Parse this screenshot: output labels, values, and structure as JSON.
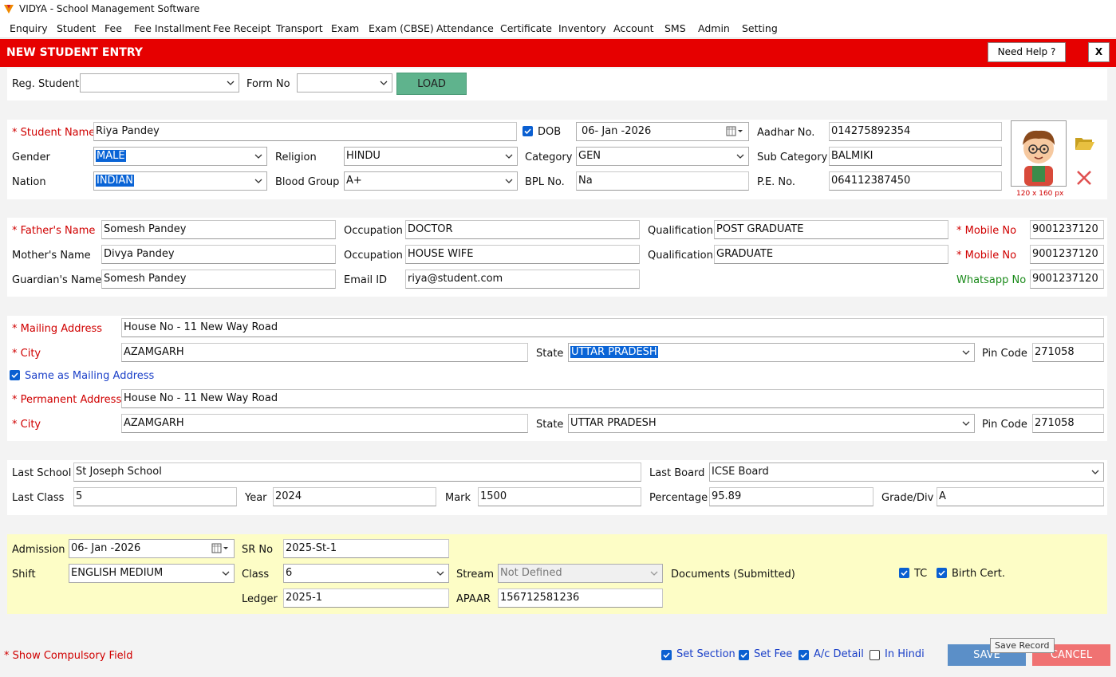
{
  "window": {
    "title": "VIDYA - School Management Software",
    "logo_icon": "vidya-logo-icon"
  },
  "menu": [
    "Enquiry",
    "Student",
    "Fee",
    "Fee Installment",
    "Fee Receipt",
    "Transport",
    "Exam",
    "Exam (CBSE)",
    "Attendance",
    "Certificate",
    "Inventory",
    "Account",
    "SMS",
    "Admin",
    "Setting"
  ],
  "header": {
    "title": "NEW STUDENT ENTRY",
    "help_label": "Need Help ?",
    "close_label": "X",
    "color": "#e60000"
  },
  "load_bar": {
    "reg_label": "Reg. Student",
    "reg_value": "",
    "form_label": "Form No",
    "form_value": "",
    "load_label": "LOAD"
  },
  "student": {
    "name_label": "* Student Name",
    "name": "Riya Pandey",
    "dob_label": "DOB",
    "dob": "06- Jan -2026",
    "dob_checked": true,
    "aadhar_label": "Aadhar No.",
    "aadhar": "014275892354",
    "gender_label": "Gender",
    "gender": "MALE",
    "religion_label": "Religion",
    "religion": "HINDU",
    "category_label": "Category",
    "category": "GEN",
    "subcat_label": "Sub Category",
    "subcat": "BALMIKI",
    "nation_label": "Nation",
    "nation": "INDIAN",
    "blood_label": "Blood Group",
    "blood": "A+",
    "bpl_label": "BPL No.",
    "bpl": "Na",
    "pe_label": "P.E. No.",
    "pe": "064112387450",
    "photo_size": "120 x 160 px"
  },
  "parents": {
    "father_label": "* Father's Name",
    "father": "Somesh Pandey",
    "occ_label": "Occupation",
    "father_occ": "DOCTOR",
    "qual_label": "Qualification",
    "father_qual": "POST GRADUATE",
    "mobile_label1": "* Mobile  No",
    "father_mobile": "9001237120",
    "mother_label": "Mother's Name",
    "mother": "Divya Pandey",
    "mother_occ": "HOUSE WIFE",
    "mother_qual": "GRADUATE",
    "mobile_label2": "* Mobile No",
    "mother_mobile": "9001237120",
    "guardian_label": "Guardian's Name",
    "guardian": "Somesh Pandey",
    "email_label": "Email ID",
    "email": "riya@student.com",
    "whatsapp_label": "Whatsapp No",
    "whatsapp": "9001237120"
  },
  "address": {
    "mailing_label": "* Mailing Address",
    "mailing": "House No - 11 New Way Road",
    "city_label": "* City",
    "mailing_city": "AZAMGARH",
    "state_label": "State",
    "mailing_state": "UTTAR PRADESH",
    "pin_label": "Pin Code",
    "mailing_pin": "271058",
    "same_label": "Same as Mailing Address",
    "same_checked": true,
    "permanent_label": "* Permanent Address",
    "permanent": "House No - 11 New Way Road",
    "permanent_city": "AZAMGARH",
    "permanent_state": "UTTAR PRADESH",
    "permanent_pin": "271058"
  },
  "previous": {
    "school_label": "Last School",
    "school": "St Joseph School",
    "board_label": "Last Board",
    "board": "ICSE Board",
    "class_label": "Last Class",
    "class": "5",
    "year_label": "Year",
    "year": "2024",
    "mark_label": "Mark",
    "mark": "1500",
    "pct_label": "Percentage",
    "pct": "95.89",
    "grade_label": "Grade/Div",
    "grade": "A"
  },
  "admission": {
    "adm_label": "Admission",
    "adm_date": "06- Jan -2026",
    "sr_label": "SR No",
    "sr": "2025-St-1",
    "shift_label": "Shift",
    "shift": "ENGLISH MEDIUM",
    "class_label": "Class",
    "class": "6",
    "stream_label": "Stream",
    "stream": "Not Defined",
    "docs_label": "Documents (Submitted)",
    "tc_label": "TC",
    "tc_checked": true,
    "birth_label": "Birth Cert.",
    "birth_checked": true,
    "ledger_label": "Ledger",
    "ledger": "2025-1",
    "apaar_label": "APAAR",
    "apaar": "156712581236",
    "bg_color": "#fdfdc6"
  },
  "footer": {
    "compulsory_label": "* Show Compulsory Field",
    "set_section_label": "Set Section",
    "set_section": true,
    "set_fee_label": "Set Fee",
    "set_fee": true,
    "ac_detail_label": "A/c Detail",
    "ac_detail": true,
    "hindi_label": "In Hindi",
    "hindi": false,
    "save_label": "SAVE",
    "cancel_label": "CANCEL",
    "tooltip": "Save Record",
    "save_color": "#5b8fc8",
    "cancel_color": "#f07272"
  }
}
